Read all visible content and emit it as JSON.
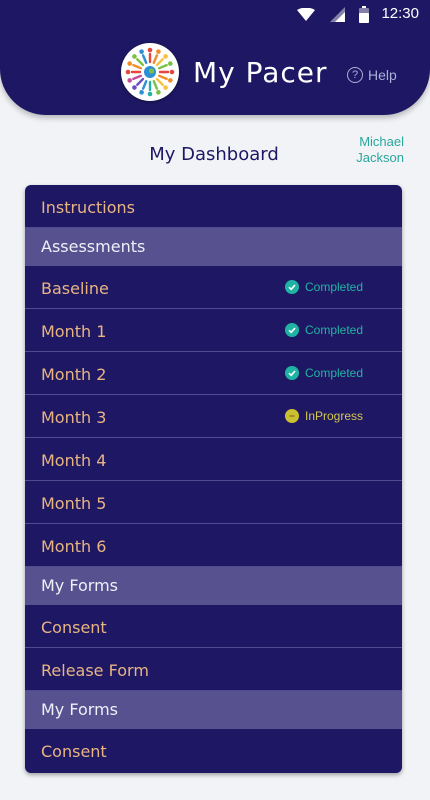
{
  "statusbar": {
    "time": "12:30"
  },
  "header": {
    "title": "My Pacer",
    "help_label": "Help",
    "help_glyph": "?"
  },
  "dashboard": {
    "title": "My Dashboard",
    "user_name_line1": "Michael",
    "user_name_line2": "Jackson"
  },
  "colors": {
    "primary": "#1e1864",
    "section": "#57528f",
    "item_text": "#e8b482",
    "completed": "#23b3a3",
    "in_progress": "#cbbf32",
    "user_name": "#2aa79c"
  },
  "menu": {
    "instructions": "Instructions",
    "assessments_header": "Assessments",
    "assessments": [
      {
        "label": "Baseline",
        "status": "Completed",
        "status_icon": "check-circle-icon"
      },
      {
        "label": "Month 1",
        "status": "Completed",
        "status_icon": "check-circle-icon"
      },
      {
        "label": "Month 2",
        "status": "Completed",
        "status_icon": "check-circle-icon"
      },
      {
        "label": "Month 3",
        "status": "InProgress",
        "status_icon": "in-progress-icon"
      },
      {
        "label": "Month 4"
      },
      {
        "label": "Month 5"
      },
      {
        "label": "Month 6"
      }
    ],
    "forms_header_1": "My Forms",
    "forms_1": [
      {
        "label": "Consent"
      },
      {
        "label": "Release Form"
      }
    ],
    "forms_header_2": "My Forms",
    "forms_2": [
      {
        "label": "Consent"
      }
    ]
  }
}
